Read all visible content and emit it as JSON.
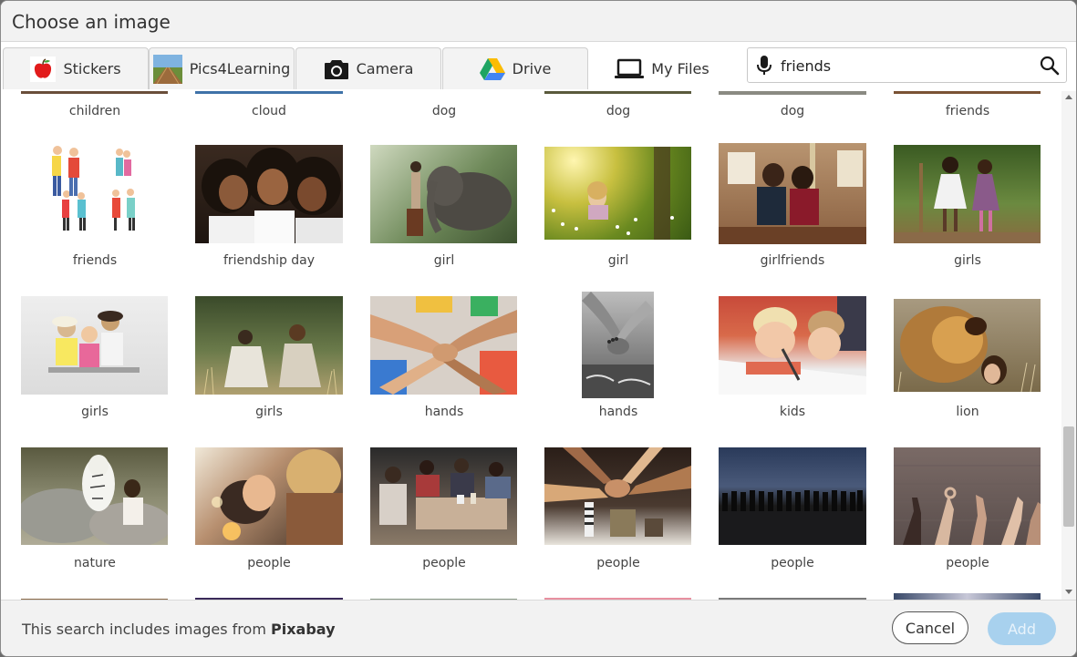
{
  "dialog": {
    "title": "Choose an image"
  },
  "tabs": [
    {
      "label": "Stickers",
      "icon": "apple-icon",
      "active": false
    },
    {
      "label": "Pics4Learning",
      "icon": "landscape-icon",
      "active": false
    },
    {
      "label": "Camera",
      "icon": "camera-icon",
      "active": false
    },
    {
      "label": "Drive",
      "icon": "drive-icon",
      "active": false
    },
    {
      "label": "My Files",
      "icon": "laptop-icon",
      "active": true
    }
  ],
  "search": {
    "value": "friends",
    "mic_icon": "microphone-icon",
    "search_icon": "search-icon"
  },
  "gallery": {
    "rows": [
      [
        "children",
        "cloud",
        "dog",
        "dog",
        "dog",
        "friends"
      ],
      [
        "friends",
        "friendship day",
        "girl",
        "girl",
        "girlfriends",
        "girls"
      ],
      [
        "girls",
        "girls",
        "hands",
        "hands",
        "kids",
        "lion"
      ],
      [
        "nature",
        "people",
        "people",
        "people",
        "people",
        "people"
      ]
    ]
  },
  "footer": {
    "note_prefix": "This search includes images from ",
    "note_source": "Pixabay",
    "cancel_label": "Cancel",
    "add_label": "Add"
  },
  "colors": {
    "accent_disabled": "#a8d1ee",
    "titlebar": "#f2f2f2"
  }
}
